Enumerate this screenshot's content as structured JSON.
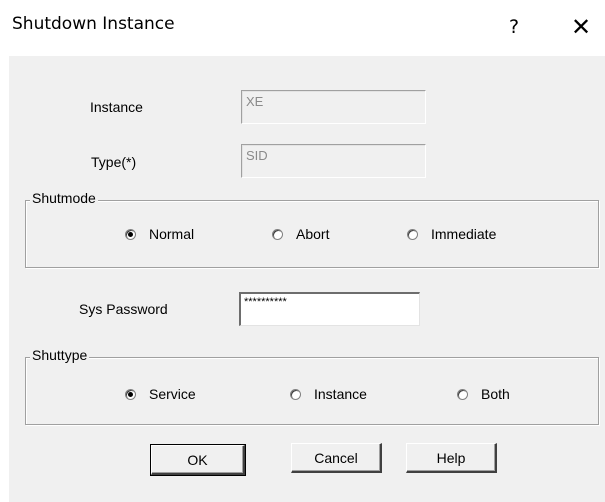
{
  "window": {
    "title": "Shutdown Instance",
    "help_glyph": "?",
    "close_glyph": "✕"
  },
  "fields": {
    "instance_label": "Instance",
    "instance_value": "XE",
    "type_label": "Type(*)",
    "type_value": "SID",
    "password_label": "Sys Password",
    "password_value": "**********"
  },
  "shutmode": {
    "legend": "Shutmode",
    "options": [
      {
        "label": "Normal",
        "selected": true
      },
      {
        "label": "Abort",
        "selected": false
      },
      {
        "label": "Immediate",
        "selected": false
      }
    ]
  },
  "shuttype": {
    "legend": "Shuttype",
    "options": [
      {
        "label": "Service",
        "selected": true
      },
      {
        "label": "Instance",
        "selected": false
      },
      {
        "label": "Both",
        "selected": false
      }
    ]
  },
  "buttons": {
    "ok": "OK",
    "cancel": "Cancel",
    "help": "Help"
  }
}
